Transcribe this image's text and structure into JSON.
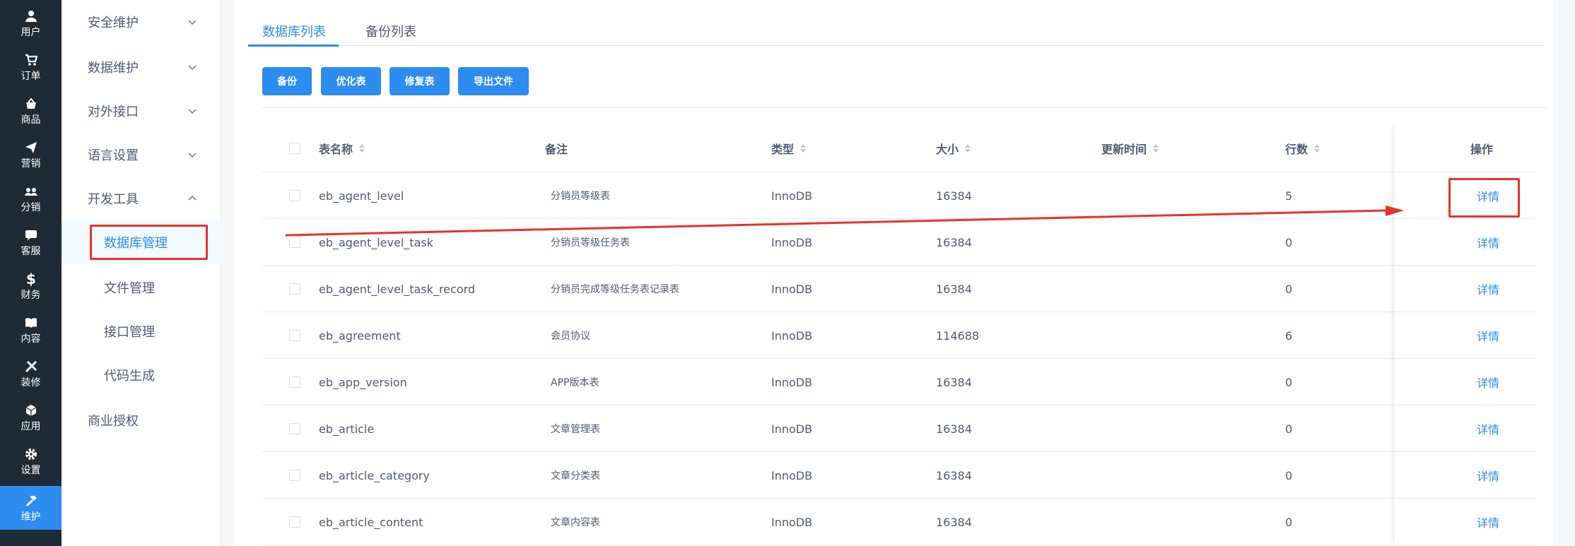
{
  "rail": {
    "items": [
      {
        "label": "用户",
        "icon": "user-icon"
      },
      {
        "label": "订单",
        "icon": "cart-icon"
      },
      {
        "label": "商品",
        "icon": "bag-icon"
      },
      {
        "label": "营销",
        "icon": "send-icon"
      },
      {
        "label": "分销",
        "icon": "group-icon"
      },
      {
        "label": "客服",
        "icon": "chat-icon"
      },
      {
        "label": "财务",
        "icon": "dollar-icon"
      },
      {
        "label": "内容",
        "icon": "book-icon"
      },
      {
        "label": "装修",
        "icon": "tools-icon"
      },
      {
        "label": "应用",
        "icon": "cube-icon"
      },
      {
        "label": "设置",
        "icon": "gear-icon"
      },
      {
        "label": "维护",
        "icon": "hammer-icon",
        "active": true
      }
    ]
  },
  "submenu": {
    "groups": [
      {
        "label": "安全维护",
        "expanded": false
      },
      {
        "label": "数据维护",
        "expanded": false
      },
      {
        "label": "对外接口",
        "expanded": false
      },
      {
        "label": "语言设置",
        "expanded": false
      },
      {
        "label": "开发工具",
        "expanded": true
      }
    ],
    "leaves": [
      {
        "label": "数据库管理",
        "active": true
      },
      {
        "label": "文件管理"
      },
      {
        "label": "接口管理"
      },
      {
        "label": "代码生成"
      }
    ],
    "last_group": "商业授权"
  },
  "tabs": [
    {
      "label": "数据库列表",
      "active": true
    },
    {
      "label": "备份列表"
    }
  ],
  "toolbar": {
    "backup": "备份",
    "optimize": "优化表",
    "repair": "修复表",
    "export": "导出文件"
  },
  "table": {
    "headers": {
      "name": "表名称",
      "remark": "备注",
      "type": "类型",
      "size": "大小",
      "updated": "更新时间",
      "rows": "行数",
      "action": "操作"
    },
    "rows": [
      {
        "name": "eb_agent_level",
        "remark": "分销员等级表",
        "type": "InnoDB",
        "size": "16384",
        "updated": "",
        "rows": "5",
        "action": "详情"
      },
      {
        "name": "eb_agent_level_task",
        "remark": "分销员等级任务表",
        "type": "InnoDB",
        "size": "16384",
        "updated": "",
        "rows": "0",
        "action": "详情"
      },
      {
        "name": "eb_agent_level_task_record",
        "remark": "分销员完成等级任务表记录表",
        "type": "InnoDB",
        "size": "16384",
        "updated": "",
        "rows": "0",
        "action": "详情"
      },
      {
        "name": "eb_agreement",
        "remark": "会员协议",
        "type": "InnoDB",
        "size": "114688",
        "updated": "",
        "rows": "6",
        "action": "详情"
      },
      {
        "name": "eb_app_version",
        "remark": "APP版本表",
        "type": "InnoDB",
        "size": "16384",
        "updated": "",
        "rows": "0",
        "action": "详情"
      },
      {
        "name": "eb_article",
        "remark": "文章管理表",
        "type": "InnoDB",
        "size": "16384",
        "updated": "",
        "rows": "0",
        "action": "详情"
      },
      {
        "name": "eb_article_category",
        "remark": "文章分类表",
        "type": "InnoDB",
        "size": "16384",
        "updated": "",
        "rows": "0",
        "action": "详情"
      },
      {
        "name": "eb_article_content",
        "remark": "文章内容表",
        "type": "InnoDB",
        "size": "16384",
        "updated": "",
        "rows": "0",
        "action": "详情"
      }
    ]
  },
  "colors": {
    "primary": "#2d8cf0",
    "rail_bg": "#1c2b36",
    "annotation_red": "#e8332a"
  }
}
